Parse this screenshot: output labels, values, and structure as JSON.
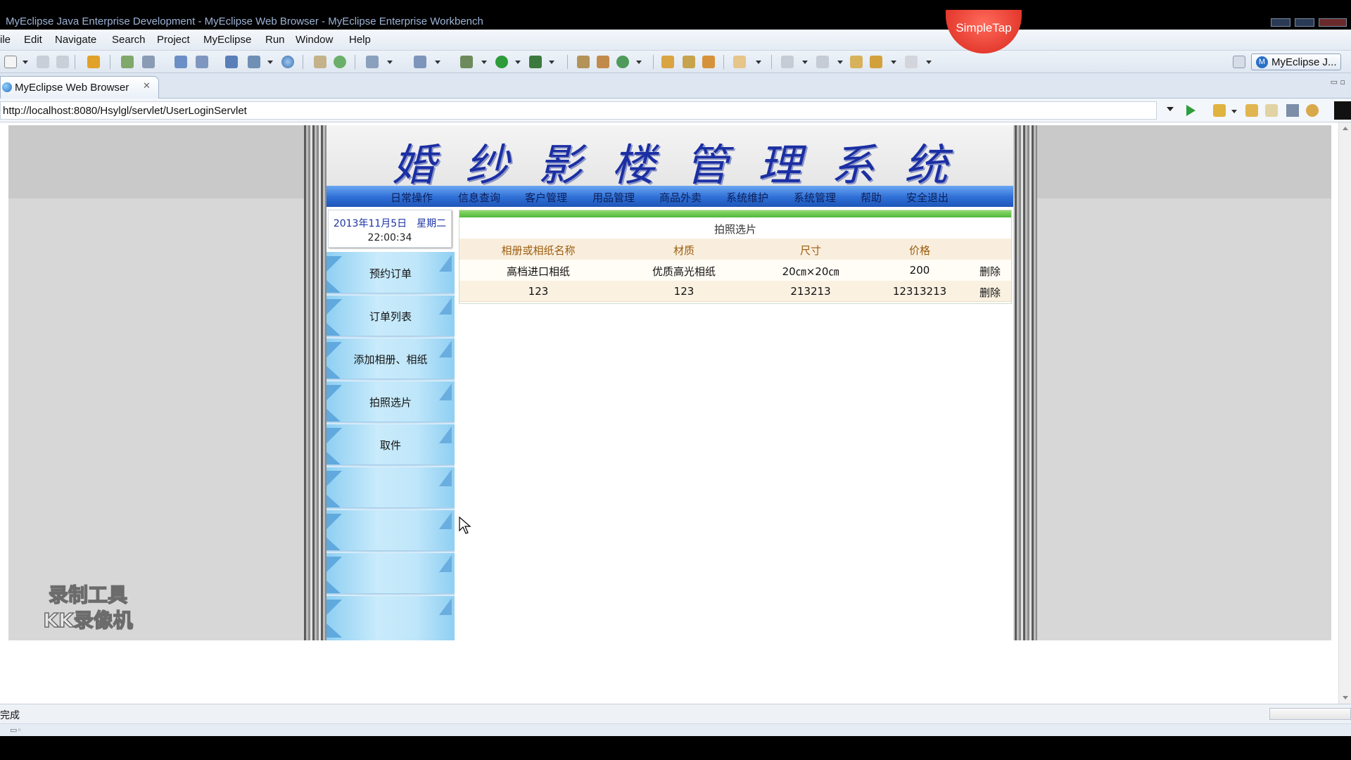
{
  "window": {
    "title": "MyEclipse Java Enterprise Development - MyEclipse Web Browser - MyEclipse Enterprise Workbench",
    "overlay_badge": "SimpleTap"
  },
  "menu": [
    "ile",
    "Edit",
    "Navigate",
    "Search",
    "Project",
    "MyEclipse",
    "Run",
    "Window",
    "Help"
  ],
  "toolbar": {
    "perspective_label": "MyEclipse J...",
    "perspective_icon": "M"
  },
  "editor_tab": {
    "label": "MyEclipse Web Browser",
    "close": "✕"
  },
  "browser": {
    "url": "http://localhost:8080/Hsylgl/servlet/UserLoginServlet"
  },
  "site": {
    "title": "婚纱影楼管理系统",
    "nav": [
      "日常操作",
      "信息查询",
      "客户管理",
      "用品管理",
      "商品外卖",
      "系统维护",
      "系统管理",
      "帮助",
      "安全退出"
    ],
    "date": "2013年11月5日　星期二",
    "time": "22:00:34",
    "left_menu": [
      "预约订单",
      "订单列表",
      "添加相册、相纸",
      "拍照选片",
      "取件",
      "",
      "",
      "",
      ""
    ],
    "section_title": "拍照选片",
    "table": {
      "headers": [
        "相册或相纸名称",
        "材质",
        "尺寸",
        "价格",
        ""
      ],
      "rows": [
        [
          "高档进口相纸",
          "优质高光相纸",
          "20㎝×20㎝",
          "200",
          "删除"
        ],
        [
          "123",
          "123",
          "213213",
          "12313213",
          "删除"
        ]
      ]
    }
  },
  "watermark": {
    "line1": "录制工具",
    "line2": "KK录像机"
  },
  "status": {
    "text": "完成"
  },
  "colors": {
    "site_title": "#1b2fa3",
    "navbar": "#2e6fd6",
    "left_menu": "#bfe6fa",
    "header_text": "#9b5d10",
    "green_bar": "#4fb83a"
  }
}
